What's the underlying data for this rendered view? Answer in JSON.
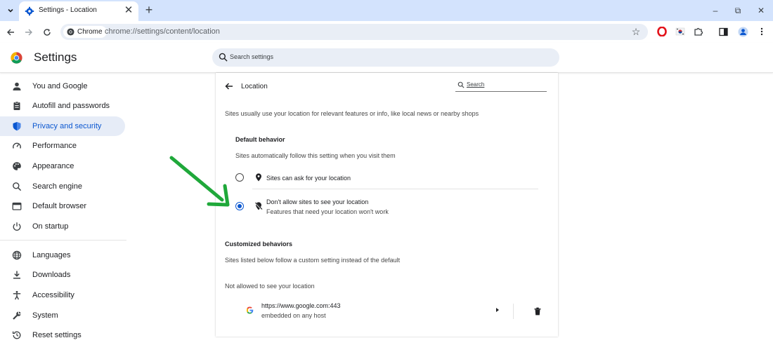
{
  "browser": {
    "tab_title": "Settings - Location",
    "tab_close": "✕",
    "new_tab": "+",
    "chip_label": "Chrome",
    "url": "chrome://settings/content/location",
    "window_controls": {
      "minimize": "–",
      "restore": "⧉",
      "close": "✕"
    },
    "star": "☆"
  },
  "header": {
    "title": "Settings",
    "search_placeholder": "Search settings"
  },
  "sidebar": {
    "items": [
      {
        "label": "You and Google",
        "icon": "person-icon"
      },
      {
        "label": "Autofill and passwords",
        "icon": "clipboard-icon"
      },
      {
        "label": "Privacy and security",
        "icon": "shield-icon",
        "active": true
      },
      {
        "label": "Performance",
        "icon": "speedometer-icon"
      },
      {
        "label": "Appearance",
        "icon": "palette-icon"
      },
      {
        "label": "Search engine",
        "icon": "search-icon"
      },
      {
        "label": "Default browser",
        "icon": "browser-icon"
      },
      {
        "label": "On startup",
        "icon": "power-icon"
      },
      {
        "label": "Languages",
        "icon": "globe-icon"
      },
      {
        "label": "Downloads",
        "icon": "download-icon"
      },
      {
        "label": "Accessibility",
        "icon": "accessibility-icon"
      },
      {
        "label": "System",
        "icon": "wrench-icon"
      },
      {
        "label": "Reset settings",
        "icon": "reset-icon"
      }
    ]
  },
  "main": {
    "heading": "Location",
    "search_label": "Search",
    "description": "Sites usually use your location for relevant features or info, like local news or nearby shops",
    "default_behavior": {
      "title": "Default behavior",
      "subtitle": "Sites automatically follow this setting when you visit them",
      "options": [
        {
          "label": "Sites can ask for your location",
          "checked": false
        },
        {
          "label": "Don't allow sites to see your location",
          "sublabel": "Features that need your location won't work",
          "checked": true
        }
      ]
    },
    "customized": {
      "title": "Customized behaviors",
      "subtitle": "Sites listed below follow a custom setting instead of the default",
      "not_allowed_title": "Not allowed to see your location",
      "sites": [
        {
          "url": "https://www.google.com:443",
          "detail": "embedded on any host"
        }
      ]
    }
  },
  "colors": {
    "accent": "#0b57d0",
    "tabstrip": "#d3e3fd",
    "active_nav_bg": "#e6ecf7",
    "annotation_arrow": "#1fa83a"
  }
}
